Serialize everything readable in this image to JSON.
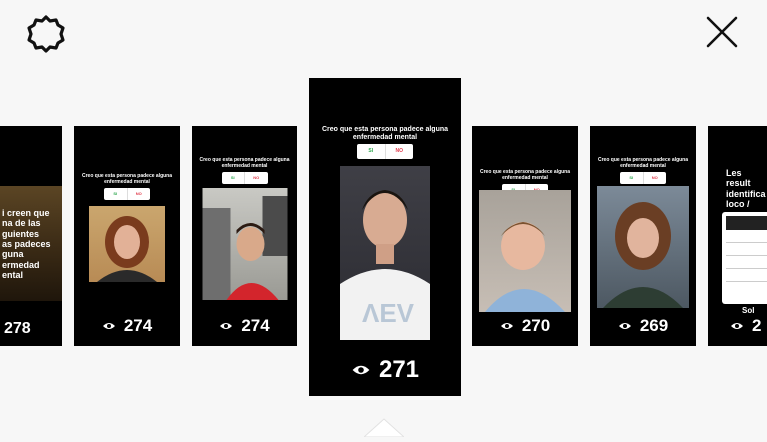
{
  "header": {
    "settings_icon": "gear-icon",
    "close_icon": "close-icon"
  },
  "colors": {
    "background": "#f7f7f7",
    "card": "#000000",
    "poll_yes": "#2fa84f",
    "poll_no": "#e0394a"
  },
  "stories": [
    {
      "id": "story-1",
      "question": "i creen que\nna de las\nguientes\nas padeces\nguna\nermedad\nental",
      "views": "278"
    },
    {
      "id": "story-2",
      "question": "Creo que esta persona padece alguna enfermedad mental",
      "poll_yes": "SI",
      "poll_no": "NO",
      "views": "274"
    },
    {
      "id": "story-3",
      "question": "Creo que esta persona padece alguna enfermedad mental",
      "poll_yes": "SI",
      "poll_no": "NO",
      "views": "274"
    },
    {
      "id": "story-4",
      "question": "Creo que esta persona padece alguna enfermedad mental",
      "poll_yes": "SI",
      "poll_no": "NO",
      "views": "271"
    },
    {
      "id": "story-5",
      "question": "Creo que esta persona padece alguna enfermedad mental",
      "poll_yes": "SI",
      "poll_no": "NO",
      "views": "270"
    },
    {
      "id": "story-6",
      "question": "Creo que esta persona padece alguna enfermedad mental",
      "poll_yes": "SI",
      "poll_no": "NO",
      "views": "269"
    },
    {
      "id": "story-7",
      "question": "Les result\nidentifica\nloco /",
      "views": "2",
      "footer": "Sol"
    }
  ]
}
